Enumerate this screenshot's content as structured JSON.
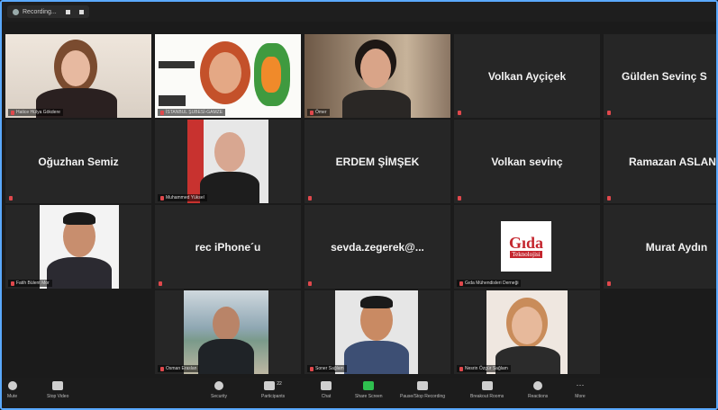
{
  "recording": {
    "label": "Recording..."
  },
  "tiles": [
    {
      "kind": "video",
      "label": "Hatice Hülya Gökdere",
      "active": true
    },
    {
      "kind": "video",
      "label": "İSTANBUL ŞUBESİ-GAMZE"
    },
    {
      "kind": "video",
      "label": "Ömer"
    },
    {
      "kind": "name",
      "name": "Volkan Ayçiçek"
    },
    {
      "kind": "name",
      "name": "Gülden Sevinç S"
    },
    {
      "kind": "name",
      "name": "Oğuzhan Semiz"
    },
    {
      "kind": "video",
      "label": "Muhammed Yüksel"
    },
    {
      "kind": "name",
      "name": "ERDEM ŞİMŞEK"
    },
    {
      "kind": "name",
      "name": "Volkan sevinç"
    },
    {
      "kind": "name",
      "name": "Ramazan ASLAN"
    },
    {
      "kind": "video",
      "label": "Fatih Bülent Mor"
    },
    {
      "kind": "name",
      "name": "rec iPhone´u"
    },
    {
      "kind": "name",
      "name": "sevda.zegerek@..."
    },
    {
      "kind": "video",
      "label": "Gıda Mühendisleri Derneği",
      "logo": [
        "Gıda",
        "Teknolojisi"
      ]
    },
    {
      "kind": "name",
      "name": "Murat Aydın"
    },
    {
      "kind": "empty"
    },
    {
      "kind": "video",
      "label": "Osman Eraslan"
    },
    {
      "kind": "video",
      "label": "Soner Sağlam"
    },
    {
      "kind": "video",
      "label": "Nesrin Özgür Sağlam"
    },
    {
      "kind": "empty"
    }
  ],
  "toolbar": {
    "mute": "Mute",
    "stop_video": "Stop Video",
    "security": "Security",
    "participants": "Participants",
    "participants_count": "22",
    "chat": "Chat",
    "share_screen": "Share Screen",
    "pause_recording": "Pause/Stop Recording",
    "breakout": "Breakout Rooms",
    "reactions": "Reactions",
    "more": "More"
  },
  "colors": {
    "accent": "#5aa9ff",
    "active_speaker": "#d7e85a",
    "share_green": "#2fbf4f",
    "muted_red": "#e0484c"
  }
}
